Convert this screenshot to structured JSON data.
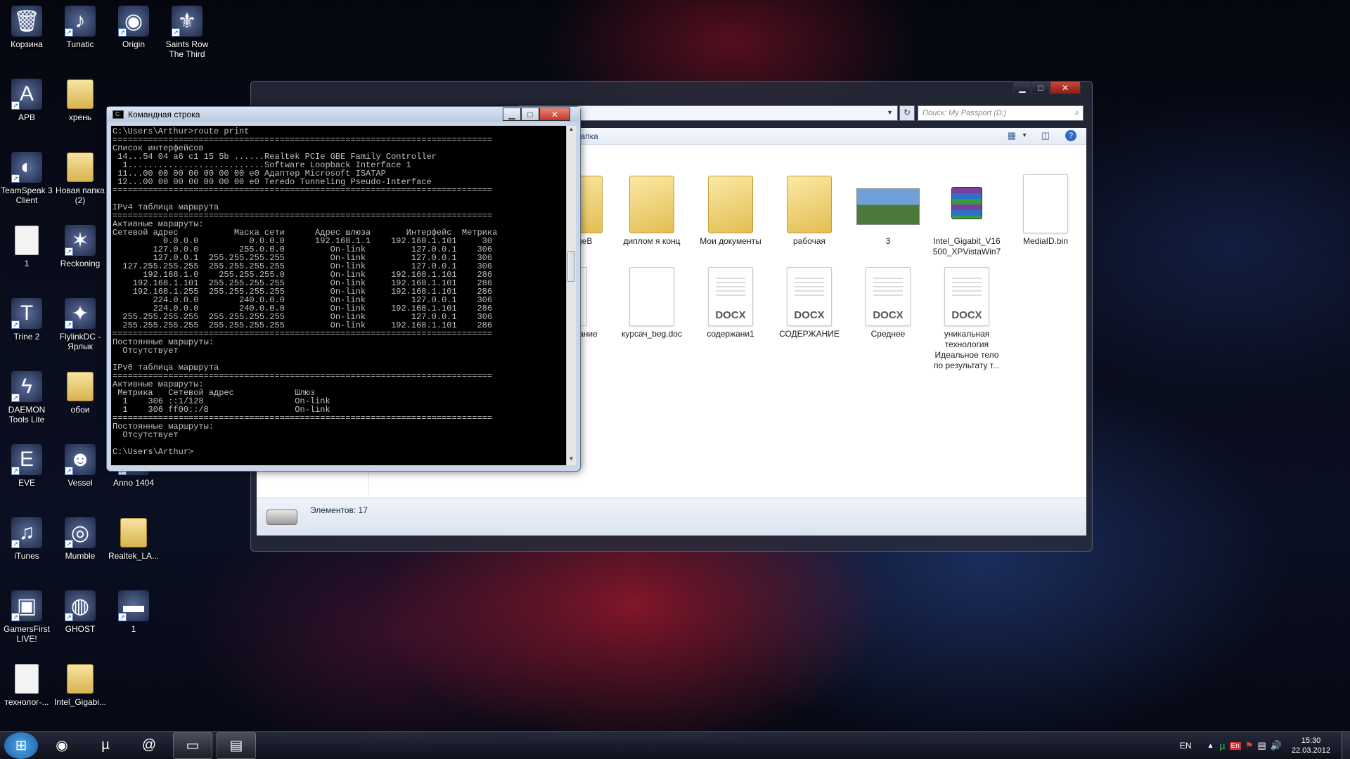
{
  "desktop": {
    "icons": [
      {
        "label": "Корзина",
        "glyph": "🗑"
      },
      {
        "label": "Tunatic",
        "glyph": "♪"
      },
      {
        "label": "Origin",
        "glyph": "◉"
      },
      {
        "label": "Saints Row The Third",
        "glyph": "⚜"
      },
      {
        "label": "APB",
        "glyph": "A"
      },
      {
        "label": "хрень",
        "glyph": ""
      },
      {
        "label": "TeamSpeak 3 Client",
        "glyph": "◐"
      },
      {
        "label": "Новая папка (2)",
        "glyph": ""
      },
      {
        "label": "1",
        "glyph": ""
      },
      {
        "label": "Reckoning",
        "glyph": "✶"
      },
      {
        "label": "Trine 2",
        "glyph": "T"
      },
      {
        "label": "FlylinkDC - Ярлык",
        "glyph": "✦"
      },
      {
        "label": "DAEMON Tools Lite",
        "glyph": "ϟ"
      },
      {
        "label": "обои",
        "glyph": ""
      },
      {
        "label": "EVE",
        "glyph": "E"
      },
      {
        "label": "Vessel",
        "glyph": "☻"
      },
      {
        "label": "Anno 1404",
        "glyph": "♜"
      },
      {
        "label": "iTunes",
        "glyph": "♫"
      },
      {
        "label": "Mumble",
        "glyph": "◎"
      },
      {
        "label": "Realtek_LA...",
        "glyph": ""
      },
      {
        "label": "GamersFirst LIVE!",
        "glyph": "▣"
      },
      {
        "label": "GHOST",
        "glyph": "◍"
      },
      {
        "label": "1",
        "glyph": "▬"
      },
      {
        "label": "технолог-...",
        "glyph": ""
      },
      {
        "label": "Intel_Gigabi...",
        "glyph": ""
      }
    ]
  },
  "explorer": {
    "search_placeholder": "Поиск: My Passport (D:)",
    "toolbar_fragment": "папка",
    "status": "Элементов: 17",
    "files": [
      {
        "name": "nageB",
        "kind": "folder"
      },
      {
        "name": "диплом я конц",
        "kind": "folder"
      },
      {
        "name": "Мои документы",
        "kind": "folder"
      },
      {
        "name": "рабочая",
        "kind": "folder"
      },
      {
        "name": "3",
        "kind": "image"
      },
      {
        "name": "Intel_Gigabit_V16 500_XPVistaWin7",
        "kind": "archive"
      },
      {
        "name": "MediaID.bin",
        "kind": "blank"
      },
      {
        "name": "ое вание",
        "kind": "partial"
      },
      {
        "name": "курсач_beg.doc",
        "kind": "blank"
      },
      {
        "name": "содержани1",
        "kind": "docx"
      },
      {
        "name": "СОДЕРЖАНИЕ",
        "kind": "docx"
      },
      {
        "name": "Среднее",
        "kind": "docx"
      },
      {
        "name": "уникальная технология Идеальное тело по результату т...",
        "kind": "docx"
      }
    ],
    "docx_tag": "DOCX"
  },
  "cmd": {
    "title": "Командная строка",
    "output": "C:\\Users\\Arthur>route print\n===========================================================================\nСписок интерфейсов\n 14...54 04 a6 c1 15 5b ......Realtek PCIe GBE Family Controller\n  1...........................Software Loopback Interface 1\n 11...00 00 00 00 00 00 00 e0 Адаптер Microsoft ISATAP\n 12...00 00 00 00 00 00 00 e0 Teredo Tunneling Pseudo-Interface\n===========================================================================\n\nIPv4 таблица маршрута\n===========================================================================\nАктивные маршруты:\nСетевой адрес           Маска сети      Адрес шлюза       Интерфейс  Метрика\n          0.0.0.0          0.0.0.0      192.168.1.1    192.168.1.101     30\n        127.0.0.0        255.0.0.0         On-link         127.0.0.1    306\n        127.0.0.1  255.255.255.255         On-link         127.0.0.1    306\n  127.255.255.255  255.255.255.255         On-link         127.0.0.1    306\n      192.168.1.0    255.255.255.0         On-link     192.168.1.101    286\n    192.168.1.101  255.255.255.255         On-link     192.168.1.101    286\n    192.168.1.255  255.255.255.255         On-link     192.168.1.101    286\n        224.0.0.0        240.0.0.0         On-link         127.0.0.1    306\n        224.0.0.0        240.0.0.0         On-link     192.168.1.101    286\n  255.255.255.255  255.255.255.255         On-link         127.0.0.1    306\n  255.255.255.255  255.255.255.255         On-link     192.168.1.101    286\n===========================================================================\nПостоянные маршруты:\n  Отсутствует\n\nIPv6 таблица маршрута\n===========================================================================\nАктивные маршруты:\n Метрика   Сетевой адрес            Шлюз\n  1    306 ::1/128                  On-link\n  1    306 ff00::/8                 On-link\n===========================================================================\nПостоянные маршруты:\n  Отсутствует\n\nC:\\Users\\Arthur>"
  },
  "taskbar": {
    "lang": "EN",
    "tray_lang": "En",
    "time": "15:30",
    "date": "22.03.2012",
    "apps": [
      {
        "name": "start-button",
        "glyph": "⊞"
      },
      {
        "name": "firefox",
        "glyph": "◉"
      },
      {
        "name": "utorrent",
        "glyph": "µ"
      },
      {
        "name": "mail-agent",
        "glyph": "@"
      },
      {
        "name": "cmd",
        "glyph": "▭"
      },
      {
        "name": "explorer",
        "glyph": "▤"
      }
    ]
  }
}
